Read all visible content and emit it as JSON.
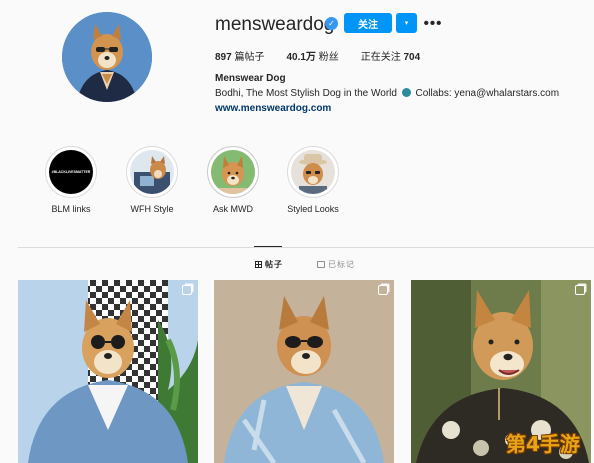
{
  "profile": {
    "username": "mensweardog",
    "follow_label": "关注",
    "dropdown_glyph": "▾",
    "more_glyph": "•••",
    "verified_glyph": "✓",
    "posts_count": "897",
    "posts_label": "篇帖子",
    "followers_count": "40.1万",
    "followers_label": "粉丝",
    "following_label": "正在关注",
    "following_count": "704",
    "full_name": "Menswear Dog",
    "bio_part1": "Bodhi, The Most Stylish Dog in the World",
    "bio_part2": "Collabs: yena@whalarstars.com",
    "website": "www.mensweardog.com"
  },
  "highlights": [
    {
      "label": "BLM links",
      "cover_text": "#BLACKLIVESMATTER"
    },
    {
      "label": "WFH Style"
    },
    {
      "label": "Ask MWD"
    },
    {
      "label": "Styled Looks"
    }
  ],
  "tabs": {
    "posts": "帖子",
    "tagged": "已标记"
  },
  "watermark": "第4手游",
  "colors": {
    "accent": "#0095f6",
    "link": "#00376b"
  }
}
